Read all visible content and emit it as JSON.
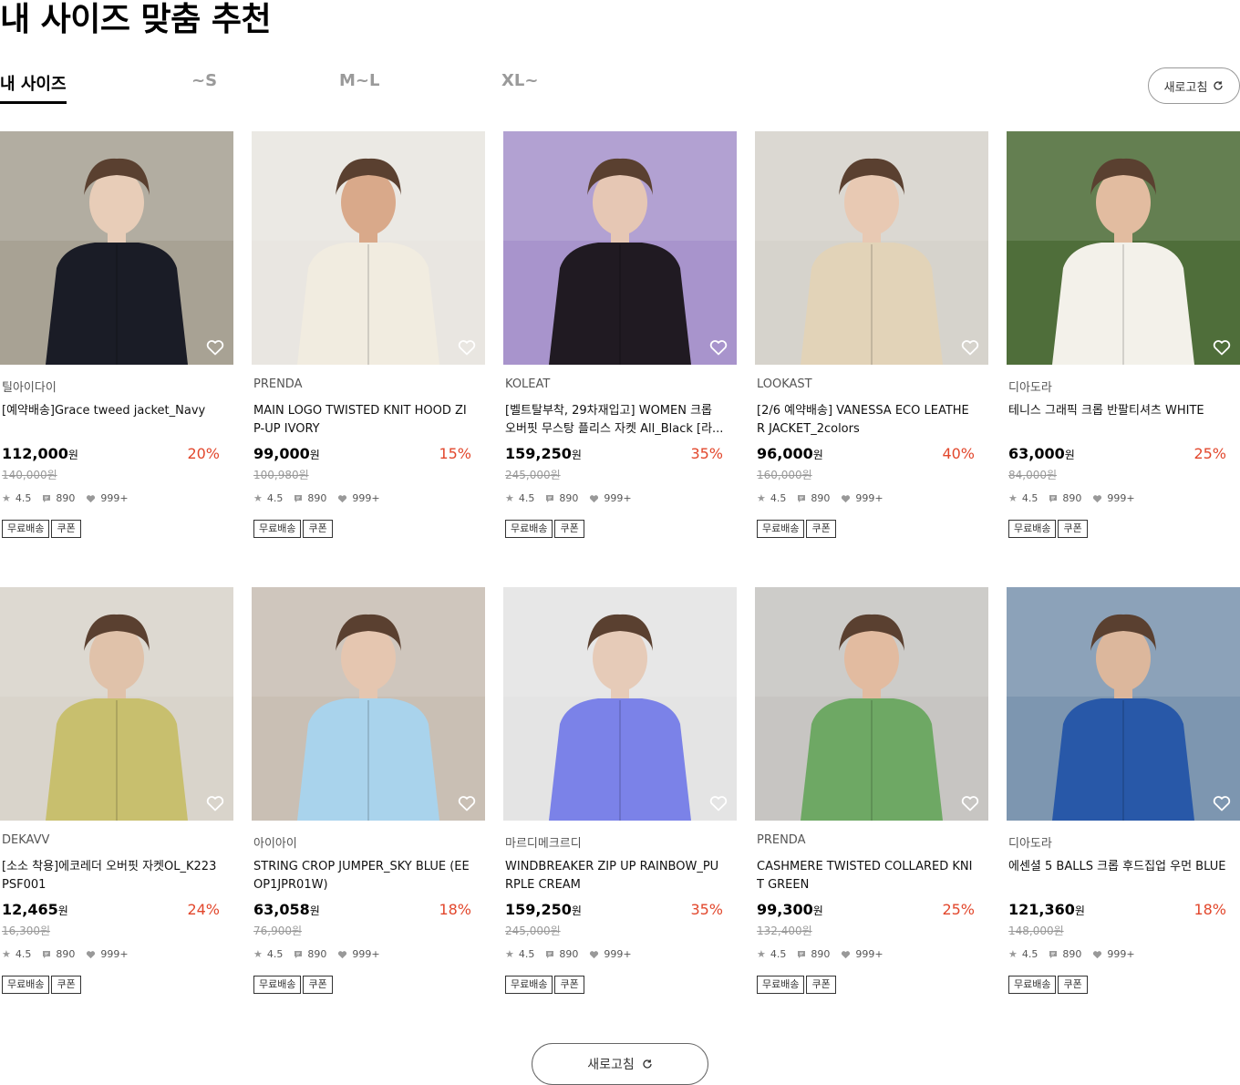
{
  "page_title": "내 사이즈 맞춤 추천",
  "tabs": [
    {
      "label": "내 사이즈",
      "active": true
    },
    {
      "label": "~S",
      "active": false
    },
    {
      "label": "M~L",
      "active": false
    },
    {
      "label": "XL~",
      "active": false
    }
  ],
  "refresh_label": "새로고침",
  "colors": {
    "accent_discount": "#e2472c",
    "muted": "#9a9a9a"
  },
  "products": [
    {
      "brand": "틸아이다이",
      "name": "[예약배송]Grace tweed jacket_Navy",
      "price": "112,000",
      "won": "원",
      "discount": "20%",
      "original": "140,000원",
      "rating": "4.5",
      "reviews": "890",
      "likes": "999+",
      "badges": [
        "무료배송",
        "쿠폰"
      ],
      "bg": "#a8a294",
      "fg": "#1a1c26",
      "skin": "#e8cdb8"
    },
    {
      "brand": "PRENDA",
      "name": "MAIN LOGO TWISTED KNIT HOOD ZIP-UP IVORY",
      "price": "99,000",
      "won": "원",
      "discount": "15%",
      "original": "100,980원",
      "rating": "4.5",
      "reviews": "890",
      "likes": "999+",
      "badges": [
        "무료배송",
        "쿠폰"
      ],
      "bg": "#e9e6e1",
      "fg": "#f1ece0",
      "skin": "#d9a98a"
    },
    {
      "brand": "KOLEAT",
      "name": "[벨트탈부착, 29차재입고] WOMEN 크롭 오버핏 무스탕 플리스 자켓 All_Black [라...",
      "price": "159,250",
      "won": "원",
      "discount": "35%",
      "original": "245,000원",
      "rating": "4.5",
      "reviews": "890",
      "likes": "999+",
      "badges": [
        "무료배송",
        "쿠폰"
      ],
      "bg": "#a894cc",
      "fg": "#201a22",
      "skin": "#e6c7b4"
    },
    {
      "brand": "LOOKAST",
      "name": "[2/6 예약배송] VANESSA ECO LEATHER JACKET_2colors",
      "price": "96,000",
      "won": "원",
      "discount": "40%",
      "original": "160,000원",
      "rating": "4.5",
      "reviews": "890",
      "likes": "999+",
      "badges": [
        "무료배송",
        "쿠폰"
      ],
      "bg": "#d6d3cc",
      "fg": "#e2d3b8",
      "skin": "#e8c9b3"
    },
    {
      "brand": "디아도라",
      "name": "테니스 그래픽 크롭 반팔티셔츠 WHITE",
      "price": "63,000",
      "won": "원",
      "discount": "25%",
      "original": "84,000원",
      "rating": "4.5",
      "reviews": "890",
      "likes": "999+",
      "badges": [
        "무료배송",
        "쿠폰"
      ],
      "bg": "#4f6e3a",
      "fg": "#f3f1ea",
      "skin": "#e2bca0"
    },
    {
      "brand": "DEKAVV",
      "name": "[소소 착용]에코레더 오버핏 자켓OL_K223PSF001",
      "price": "12,465",
      "won": "원",
      "discount": "24%",
      "original": "16,300원",
      "rating": "4.5",
      "reviews": "890",
      "likes": "999+",
      "badges": [
        "무료배송",
        "쿠폰"
      ],
      "bg": "#d9d4cb",
      "fg": "#c8bf6e",
      "skin": "#e0c2aa"
    },
    {
      "brand": "아이아이",
      "name": "STRING CROP JUMPER_SKY BLUE (EEOP1JPR01W)",
      "price": "63,058",
      "won": "원",
      "discount": "18%",
      "original": "76,900원",
      "rating": "4.5",
      "reviews": "890",
      "likes": "999+",
      "badges": [
        "무료배송",
        "쿠폰"
      ],
      "bg": "#c9bfb4",
      "fg": "#a9d3ec",
      "skin": "#e5c6b0"
    },
    {
      "brand": "마르디메크르디",
      "name": "WINDBREAKER ZIP UP RAINBOW_PURPLE CREAM",
      "price": "159,250",
      "won": "원",
      "discount": "35%",
      "original": "245,000원",
      "rating": "4.5",
      "reviews": "890",
      "likes": "999+",
      "badges": [
        "무료배송",
        "쿠폰"
      ],
      "bg": "#e4e4e4",
      "fg": "#7b82e8",
      "skin": "#e6cbb8"
    },
    {
      "brand": "PRENDA",
      "name": "CASHMERE TWISTED COLLARED KNIT GREEN",
      "price": "99,300",
      "won": "원",
      "discount": "25%",
      "original": "132,400원",
      "rating": "4.5",
      "reviews": "890",
      "likes": "999+",
      "badges": [
        "무료배송",
        "쿠폰"
      ],
      "bg": "#c7c5c2",
      "fg": "#6ea864",
      "skin": "#e2bba0"
    },
    {
      "brand": "디아도라",
      "name": "에센셜 5 BALLS 크롭 후드집업 우먼 BLUE",
      "price": "121,360",
      "won": "원",
      "discount": "18%",
      "original": "148,000원",
      "rating": "4.5",
      "reviews": "890",
      "likes": "999+",
      "badges": [
        "무료배송",
        "쿠폰"
      ],
      "bg": "#7d96b0",
      "fg": "#2858a8",
      "skin": "#dcb79c"
    }
  ]
}
